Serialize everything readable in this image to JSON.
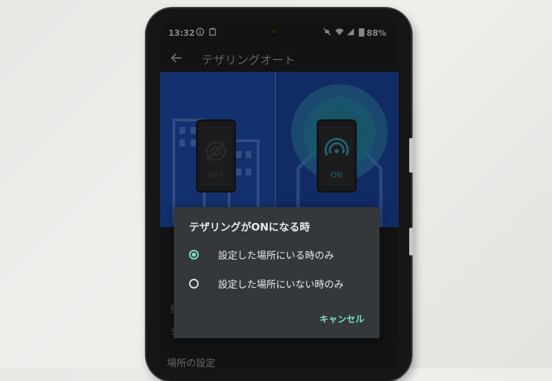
{
  "status_bar": {
    "time": "13:32",
    "battery": "88%",
    "icons": [
      "info-icon",
      "clipboard-icon",
      "mute-icon",
      "wifi-icon",
      "signal-icon"
    ]
  },
  "app_bar": {
    "back_icon": "arrow-left-icon",
    "title": "テザリングオート"
  },
  "illustration": {
    "left_phone_label": "OFF",
    "right_phone_label": "ON"
  },
  "background_labels": {
    "section_partial": "基",
    "row_partial": "テ",
    "location_settings": "場所の設定"
  },
  "dialog": {
    "title": "テザリングがONになる時",
    "options": [
      {
        "label": "設定した場所にいる時のみ",
        "selected": true
      },
      {
        "label": "設定した場所にいない時のみ",
        "selected": false
      }
    ],
    "cancel_label": "キャンセル",
    "accent_color": "#7fe0cc"
  }
}
